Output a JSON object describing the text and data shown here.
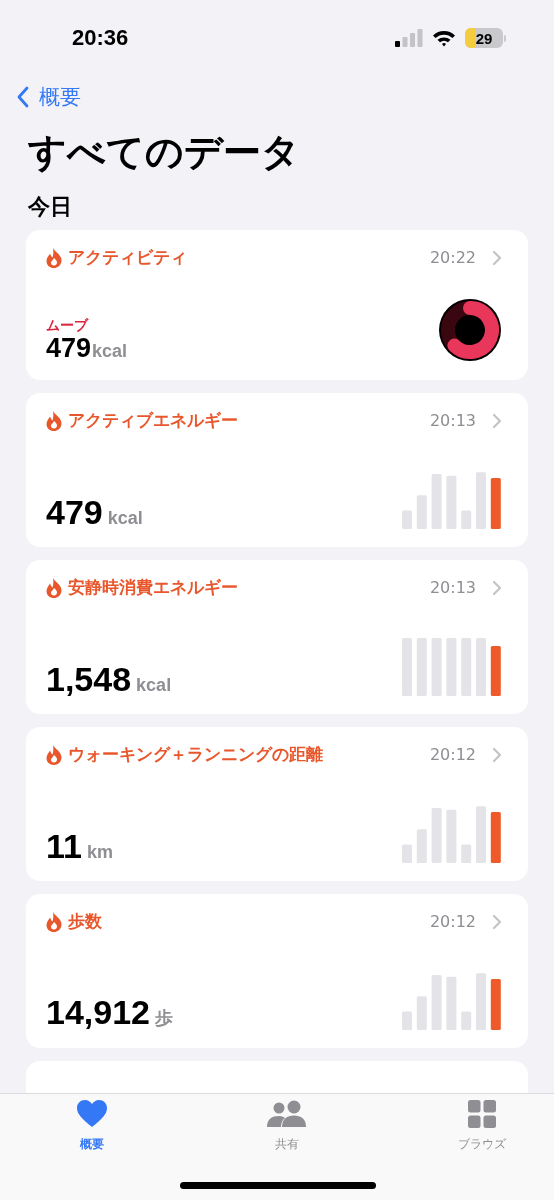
{
  "status_bar": {
    "time": "20:36",
    "battery": "29"
  },
  "nav": {
    "back": "概要"
  },
  "title": "すべてのデータ",
  "section": "今日",
  "cards": [
    {
      "kind": "ring",
      "label": "アクティビティ",
      "time": "20:22",
      "metric": "ムーブ",
      "value": "479",
      "unit": "kcal"
    },
    {
      "kind": "bars",
      "label": "アクティブエネルギー",
      "time": "20:13",
      "value": "479",
      "unit": "kcal"
    },
    {
      "kind": "even-bars",
      "label": "安静時消費エネルギー",
      "time": "20:13",
      "value": "1,548",
      "unit": "kcal"
    },
    {
      "kind": "bars",
      "label": "ウォーキング＋ランニングの距離",
      "time": "20:12",
      "value": "11",
      "unit": "km"
    },
    {
      "kind": "bars",
      "label": "歩数",
      "time": "20:12",
      "value": "14,912",
      "unit": "歩"
    }
  ],
  "tabs": [
    {
      "kind": "heart",
      "label": "概要",
      "selected": true
    },
    {
      "kind": "people",
      "label": "共有",
      "selected": false
    },
    {
      "kind": "grid",
      "label": "ブラウズ",
      "selected": false
    }
  ]
}
